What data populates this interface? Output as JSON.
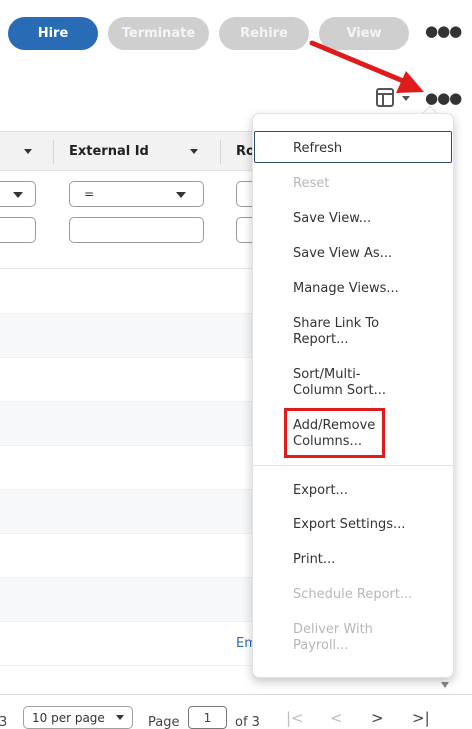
{
  "toolbar": {
    "buttons": [
      "Hire",
      "Terminate",
      "Rehire",
      "View"
    ],
    "more_icon": "more-horizontal-icon"
  },
  "grid": {
    "columns": [
      "",
      "External Id",
      "Ro"
    ],
    "filter_operator": "=",
    "row_link_text": "Em"
  },
  "menu": {
    "items": [
      {
        "label": "Refresh",
        "enabled": true
      },
      {
        "label": "Reset",
        "enabled": false
      },
      {
        "label": "Save View...",
        "enabled": true
      },
      {
        "label": "Save View As...",
        "enabled": true
      },
      {
        "label": "Manage Views...",
        "enabled": true
      },
      {
        "label": "Share Link To\nReport...",
        "enabled": true
      },
      {
        "label": "Sort/Multi-\nColumn Sort...",
        "enabled": true
      },
      {
        "label": "Add/Remove\nColumns...",
        "enabled": true
      },
      {
        "label": "Export...",
        "enabled": true
      },
      {
        "label": "Export Settings...",
        "enabled": true
      },
      {
        "label": "Print...",
        "enabled": true
      },
      {
        "label": "Schedule Report...",
        "enabled": false
      },
      {
        "label": "Deliver With\nPayroll...",
        "enabled": false
      }
    ]
  },
  "pager": {
    "left_fragment": "3",
    "per_page": "10 per page",
    "page_label": "Page",
    "page_value": "1",
    "of_label": "of 3"
  },
  "colors": {
    "primary": "#2a6bb5",
    "disabled": "#cfcfcf",
    "annotation": "#e01b1b"
  }
}
